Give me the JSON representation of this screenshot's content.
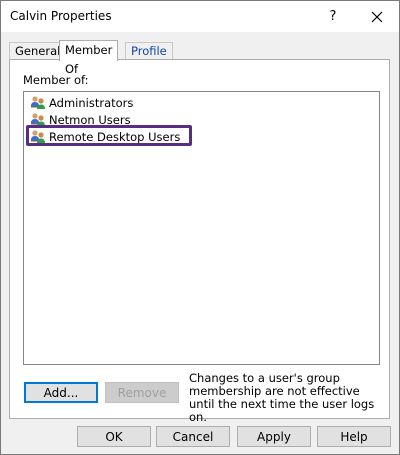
{
  "window": {
    "title": "Calvin Properties",
    "help_label": "?",
    "close_icon": "close-icon"
  },
  "tabs": [
    {
      "label": "General",
      "active": false
    },
    {
      "label": "Member Of",
      "active": true
    },
    {
      "label": "Profile",
      "active": false
    }
  ],
  "member_of": {
    "label": "Member of:",
    "groups": [
      {
        "name": "Administrators",
        "icon": "group-icon"
      },
      {
        "name": "Netmon Users",
        "icon": "group-icon"
      },
      {
        "name": "Remote Desktop Users",
        "icon": "group-icon",
        "highlighted": true
      }
    ],
    "highlight_color": "#5a2d82"
  },
  "actions": {
    "add_label": "Add...",
    "remove_label": "Remove",
    "note": "Changes to a user's group membership are not effective until the next time the user logs on."
  },
  "footer": {
    "ok_label": "OK",
    "cancel_label": "Cancel",
    "apply_label": "Apply",
    "help_label": "Help"
  }
}
